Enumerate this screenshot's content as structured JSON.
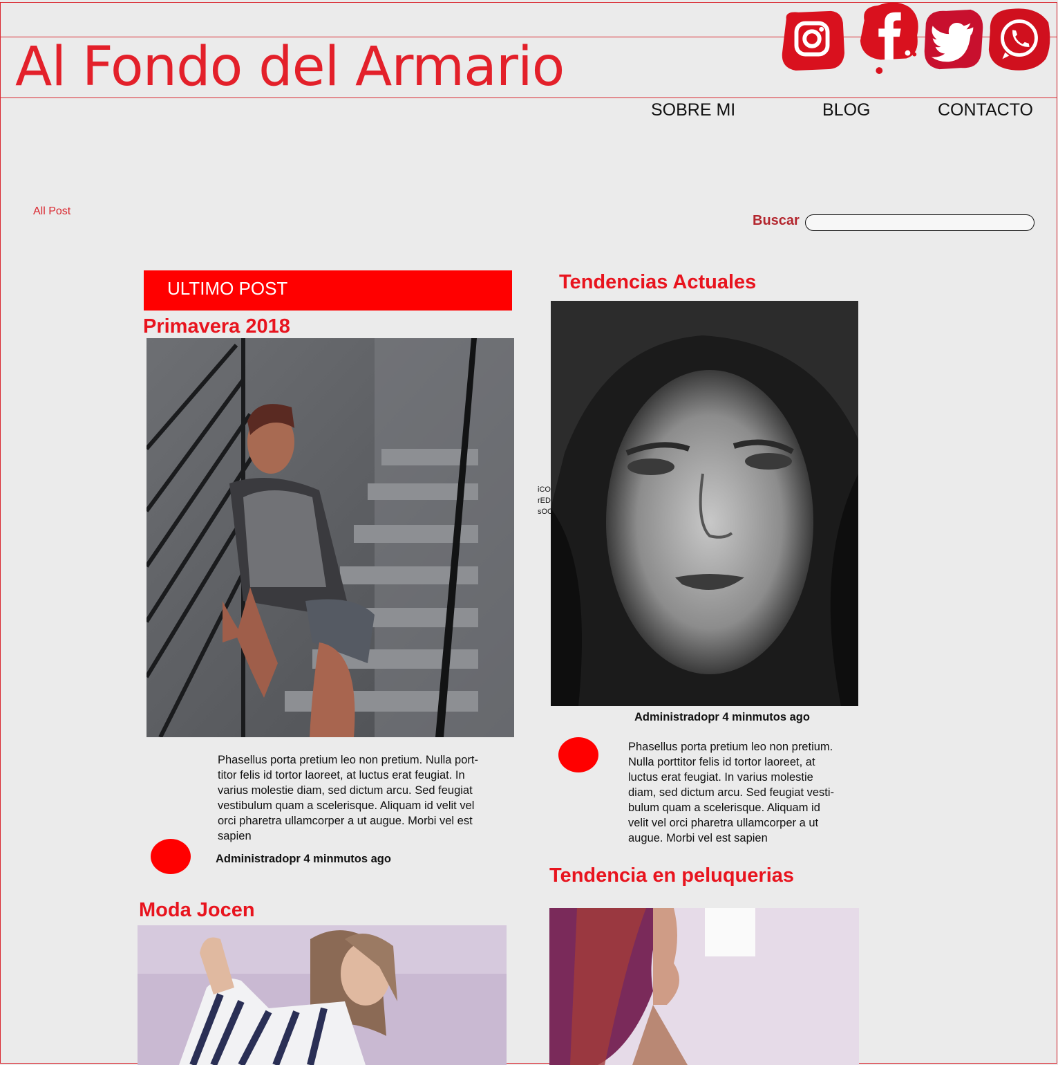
{
  "site": {
    "title": "Al Fondo del Armario"
  },
  "social": [
    {
      "name": "instagram-icon",
      "color": "#d9111e"
    },
    {
      "name": "facebook-icon",
      "color": "#d9111e"
    },
    {
      "name": "twitter-icon",
      "color": "#c8102e"
    },
    {
      "name": "whatsapp-icon",
      "color": "#d0101e"
    }
  ],
  "nav": {
    "about": "SOBRE MI",
    "blog": "BLOG",
    "contact": "CONTACTO"
  },
  "filters": {
    "all_post": "All Post"
  },
  "search": {
    "label": "Buscar",
    "placeholder": ""
  },
  "latest": {
    "banner": "ULTIMO POST"
  },
  "posts": {
    "primavera": {
      "title": "Primavera 2018",
      "excerpt": " Phasellus porta pretium leo non pretium. Nulla port-\ntitor felis id tortor laoreet, at luctus erat feugiat. In\nvarius molestie diam, sed dictum arcu. Sed feugiat\nvestibulum quam a scelerisque. Aliquam id velit vel\norci pharetra ullamcorper a ut augue. Morbi vel est\nsapien",
      "meta": "Administradopr 4 minmutos ago"
    },
    "tendencias": {
      "title": "Tendencias Actuales",
      "meta": "Administradopr 4 minmutos ago",
      "excerpt": " Phasellus porta pretium leo non pretium.\nNulla porttitor felis id tortor laoreet, at\nluctus erat feugiat. In varius molestie\ndiam, sed dictum arcu. Sed feugiat vesti-\nbulum quam a scelerisque. Aliquam id\nvelit vel orci pharetra ullamcorper a ut\naugue. Morbi vel est sapien"
    },
    "peluquerias": {
      "title": "Tendencia en peluquerias"
    },
    "moda": {
      "title": "Moda Jocen"
    }
  },
  "stray_label": "iCO\n rED\nsOC",
  "colors": {
    "accent": "#ff0000",
    "title_red": "#e3202a",
    "border": "#d9262e"
  }
}
